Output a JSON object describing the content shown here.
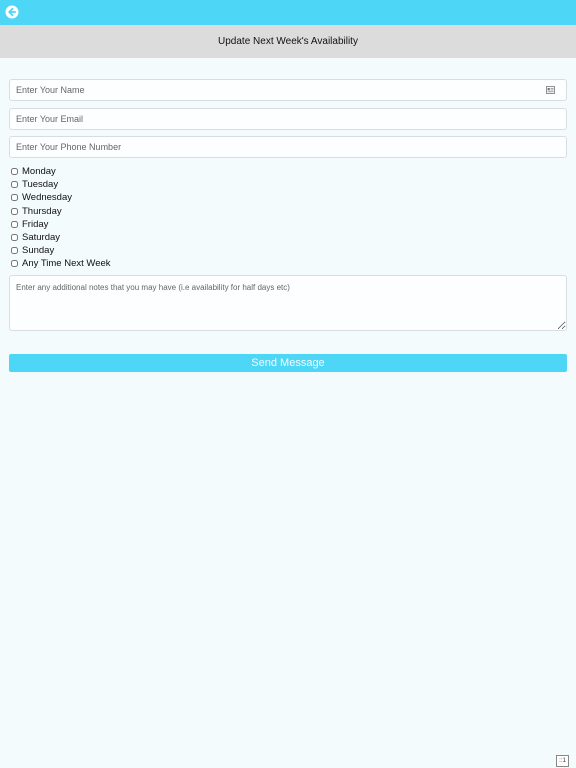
{
  "header": {
    "title": "Update Next Week's Availability",
    "back_icon": "arrow-left-circle-icon"
  },
  "form": {
    "name_placeholder": "Enter Your Name",
    "email_placeholder": "Enter Your Email",
    "phone_placeholder": "Enter Your Phone Number",
    "name_field_icon": "contact-card-icon",
    "days": [
      {
        "label": "Monday",
        "checked": false
      },
      {
        "label": "Tuesday",
        "checked": false
      },
      {
        "label": "Wednesday",
        "checked": false
      },
      {
        "label": "Thursday",
        "checked": false
      },
      {
        "label": "Friday",
        "checked": false
      },
      {
        "label": "Saturday",
        "checked": false
      },
      {
        "label": "Sunday",
        "checked": false
      },
      {
        "label": "Any Time Next Week",
        "checked": false
      }
    ],
    "notes_placeholder": "Enter any additional notes that you may have (i.e availability for half days etc)",
    "submit_label": "Send Message"
  },
  "footer": {
    "badge_text": "::1"
  },
  "colors": {
    "accent": "#4dd6f6",
    "title_bar": "#dcdcdc",
    "background": "#f4fbfd"
  }
}
